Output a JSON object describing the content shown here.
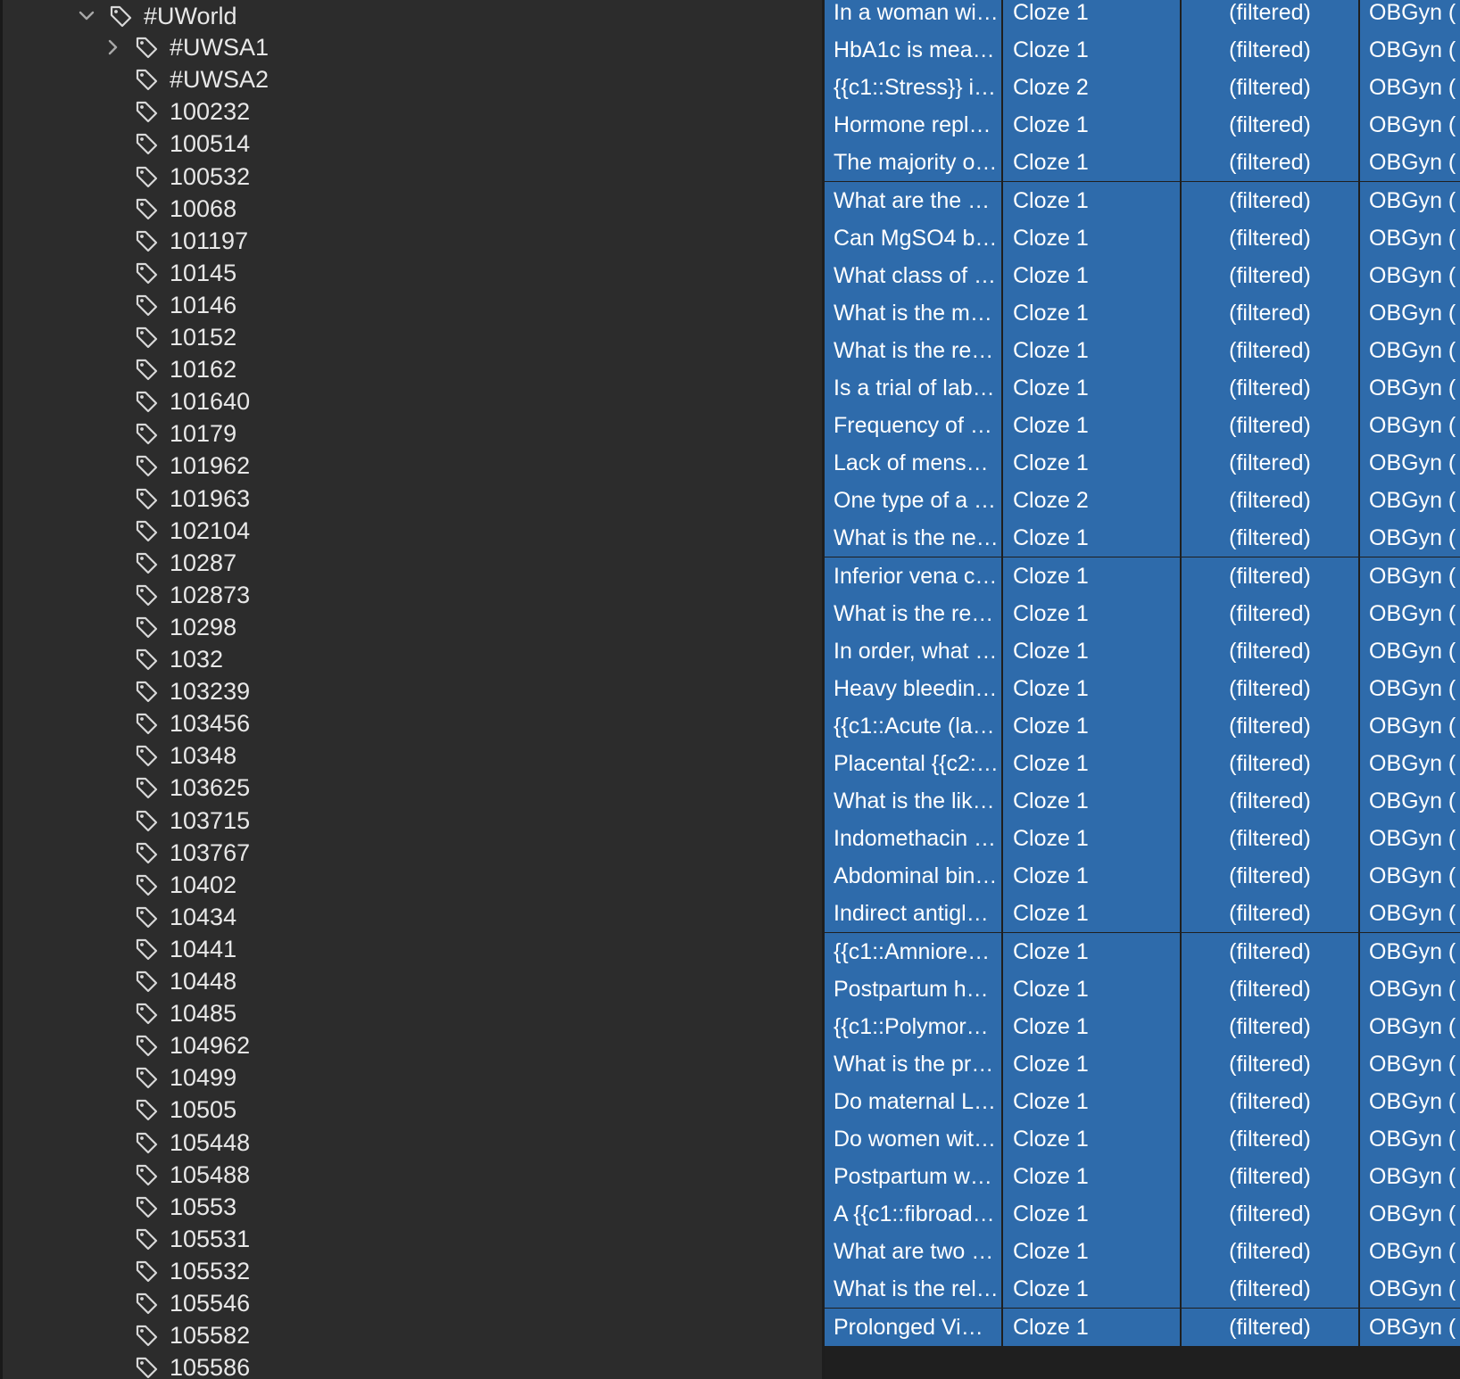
{
  "sidebar": {
    "root": {
      "label": "#UWorld",
      "expanded": true
    },
    "children": [
      {
        "label": "#UWSA1",
        "has_children": true
      },
      {
        "label": "#UWSA2"
      },
      {
        "label": "100232"
      },
      {
        "label": "100514"
      },
      {
        "label": "100532"
      },
      {
        "label": "10068"
      },
      {
        "label": "101197"
      },
      {
        "label": "10145"
      },
      {
        "label": "10146"
      },
      {
        "label": "10152"
      },
      {
        "label": "10162"
      },
      {
        "label": "101640"
      },
      {
        "label": "10179"
      },
      {
        "label": "101962"
      },
      {
        "label": "101963"
      },
      {
        "label": "102104"
      },
      {
        "label": "10287"
      },
      {
        "label": "102873"
      },
      {
        "label": "10298"
      },
      {
        "label": "1032"
      },
      {
        "label": "103239"
      },
      {
        "label": "103456"
      },
      {
        "label": "10348"
      },
      {
        "label": "103625"
      },
      {
        "label": "103715"
      },
      {
        "label": "103767"
      },
      {
        "label": "10402"
      },
      {
        "label": "10434"
      },
      {
        "label": "10441"
      },
      {
        "label": "10448"
      },
      {
        "label": "10485"
      },
      {
        "label": "104962"
      },
      {
        "label": "10499"
      },
      {
        "label": "10505"
      },
      {
        "label": "105448"
      },
      {
        "label": "105488"
      },
      {
        "label": "10553"
      },
      {
        "label": "105531"
      },
      {
        "label": "105532"
      },
      {
        "label": "105546"
      },
      {
        "label": "105582"
      },
      {
        "label": "105586"
      }
    ]
  },
  "table": {
    "rows": [
      {
        "sort": "In a woman wi…",
        "card": "Cloze 1",
        "due": "(filtered)",
        "deck": "OBGyn ("
      },
      {
        "sort": "HbA1c is mea…",
        "card": "Cloze 1",
        "due": "(filtered)",
        "deck": "OBGyn ("
      },
      {
        "sort": "{{c1::Stress}} i…",
        "card": "Cloze 2",
        "due": "(filtered)",
        "deck": "OBGyn ("
      },
      {
        "sort": "Hormone repl…",
        "card": "Cloze 1",
        "due": "(filtered)",
        "deck": "OBGyn ("
      },
      {
        "sort": "The majority o…",
        "card": "Cloze 1",
        "due": "(filtered)",
        "deck": "OBGyn ("
      },
      {
        "sort": "What are the …",
        "card": "Cloze 1",
        "due": "(filtered)",
        "deck": "OBGyn ("
      },
      {
        "sort": "Can MgSO4 b…",
        "card": "Cloze 1",
        "due": "(filtered)",
        "deck": "OBGyn ("
      },
      {
        "sort": "What class of …",
        "card": "Cloze 1",
        "due": "(filtered)",
        "deck": "OBGyn ("
      },
      {
        "sort": "What is the m…",
        "card": "Cloze 1",
        "due": "(filtered)",
        "deck": "OBGyn ("
      },
      {
        "sort": "What is the re…",
        "card": "Cloze 1",
        "due": "(filtered)",
        "deck": "OBGyn ("
      },
      {
        "sort": "Is a trial of lab…",
        "card": "Cloze 1",
        "due": "(filtered)",
        "deck": "OBGyn ("
      },
      {
        "sort": "Frequency of …",
        "card": "Cloze 1",
        "due": "(filtered)",
        "deck": "OBGyn ("
      },
      {
        "sort": "Lack of mens…",
        "card": "Cloze 1",
        "due": "(filtered)",
        "deck": "OBGyn ("
      },
      {
        "sort": "One type of a …",
        "card": "Cloze 2",
        "due": "(filtered)",
        "deck": "OBGyn ("
      },
      {
        "sort": "What is the ne…",
        "card": "Cloze 1",
        "due": "(filtered)",
        "deck": "OBGyn ("
      },
      {
        "sort": "Inferior vena c…",
        "card": "Cloze 1",
        "due": "(filtered)",
        "deck": "OBGyn ("
      },
      {
        "sort": "What is the re…",
        "card": "Cloze 1",
        "due": "(filtered)",
        "deck": "OBGyn ("
      },
      {
        "sort": "In order, what …",
        "card": "Cloze 1",
        "due": "(filtered)",
        "deck": "OBGyn ("
      },
      {
        "sort": "Heavy bleedin…",
        "card": "Cloze 1",
        "due": "(filtered)",
        "deck": "OBGyn ("
      },
      {
        "sort": "{{c1::Acute (la…",
        "card": "Cloze 1",
        "due": "(filtered)",
        "deck": "OBGyn ("
      },
      {
        "sort": "Placental {{c2:…",
        "card": "Cloze 1",
        "due": "(filtered)",
        "deck": "OBGyn ("
      },
      {
        "sort": "What is the lik…",
        "card": "Cloze 1",
        "due": "(filtered)",
        "deck": "OBGyn ("
      },
      {
        "sort": "Indomethacin …",
        "card": "Cloze 1",
        "due": "(filtered)",
        "deck": "OBGyn ("
      },
      {
        "sort": "Abdominal bin…",
        "card": "Cloze 1",
        "due": "(filtered)",
        "deck": "OBGyn ("
      },
      {
        "sort": "Indirect antigl…",
        "card": "Cloze 1",
        "due": "(filtered)",
        "deck": "OBGyn ("
      },
      {
        "sort": "{{c1::Amniore…",
        "card": "Cloze 1",
        "due": "(filtered)",
        "deck": "OBGyn ("
      },
      {
        "sort": "Postpartum h…",
        "card": "Cloze 1",
        "due": "(filtered)",
        "deck": "OBGyn ("
      },
      {
        "sort": "{{c1::Polymor…",
        "card": "Cloze 1",
        "due": "(filtered)",
        "deck": "OBGyn ("
      },
      {
        "sort": "What is the pr…",
        "card": "Cloze 1",
        "due": "(filtered)",
        "deck": "OBGyn ("
      },
      {
        "sort": "Do maternal L…",
        "card": "Cloze 1",
        "due": "(filtered)",
        "deck": "OBGyn ("
      },
      {
        "sort": "Do women wit…",
        "card": "Cloze 1",
        "due": "(filtered)",
        "deck": "OBGyn ("
      },
      {
        "sort": "Postpartum w…",
        "card": "Cloze 1",
        "due": "(filtered)",
        "deck": "OBGyn ("
      },
      {
        "sort": "A {{c1::fibroad…",
        "card": "Cloze 1",
        "due": "(filtered)",
        "deck": "OBGyn ("
      },
      {
        "sort": "What are two …",
        "card": "Cloze 1",
        "due": "(filtered)",
        "deck": "OBGyn ("
      },
      {
        "sort": "What is the rel…",
        "card": "Cloze 1",
        "due": "(filtered)",
        "deck": "OBGyn ("
      },
      {
        "sort": "Prolonged Vi…",
        "card": "Cloze 1",
        "due": "(filtered)",
        "deck": "OBGyn ("
      }
    ]
  },
  "colors": {
    "sidebar_bg": "#2c2c2c",
    "selection_blue": "#2e6bab",
    "text_light": "#e8e8e8"
  },
  "icons": {
    "tag": "tag-icon",
    "expanded": "chevron-down-icon",
    "collapsed": "chevron-right-icon"
  }
}
